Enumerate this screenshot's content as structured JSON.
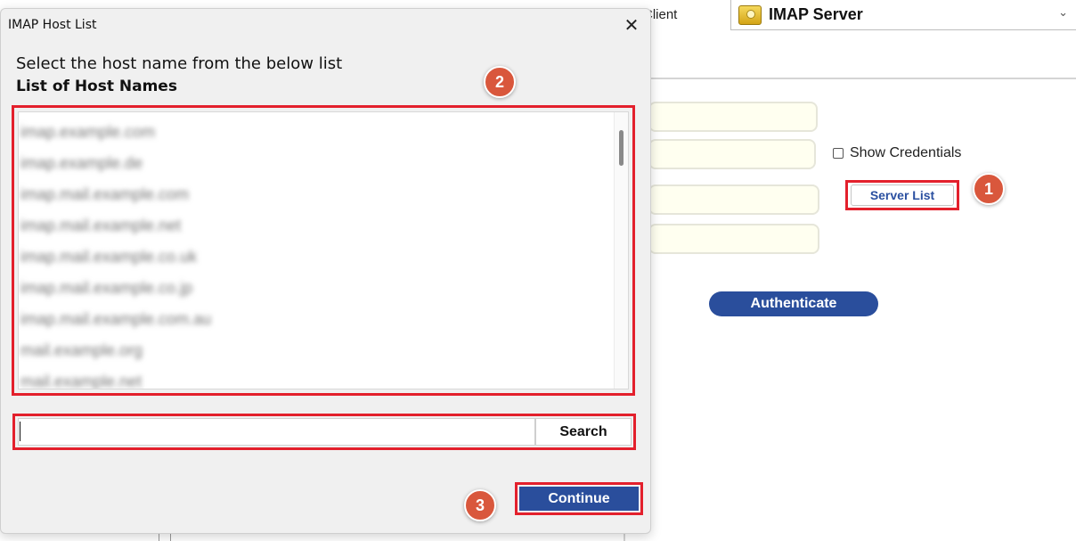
{
  "background": {
    "client_label": "Client",
    "server_select": {
      "value": "IMAP Server"
    },
    "show_credentials_label": "Show Credentials",
    "server_list_button": "Server List",
    "authenticate_button": "Authenticate"
  },
  "dialog": {
    "title": "IMAP Host List",
    "instruction": "Select the host name from the below list",
    "list_heading": "List of Host Names",
    "host_items": [
      "imap.example.com",
      "imap.example.de",
      "imap.mail.example.com",
      "imap.mail.example.net",
      "imap.mail.example.co.uk",
      "imap.mail.example.co.jp",
      "imap.mail.example.com.au",
      "mail.example.org",
      "mail.example.net"
    ],
    "search": {
      "value": "",
      "button_label": "Search"
    },
    "continue_label": "Continue"
  },
  "steps": [
    "1",
    "2",
    "3"
  ],
  "colors": {
    "highlight": "#e3202c",
    "primary_button": "#2a4e9c",
    "step_marker": "#d9573c"
  }
}
